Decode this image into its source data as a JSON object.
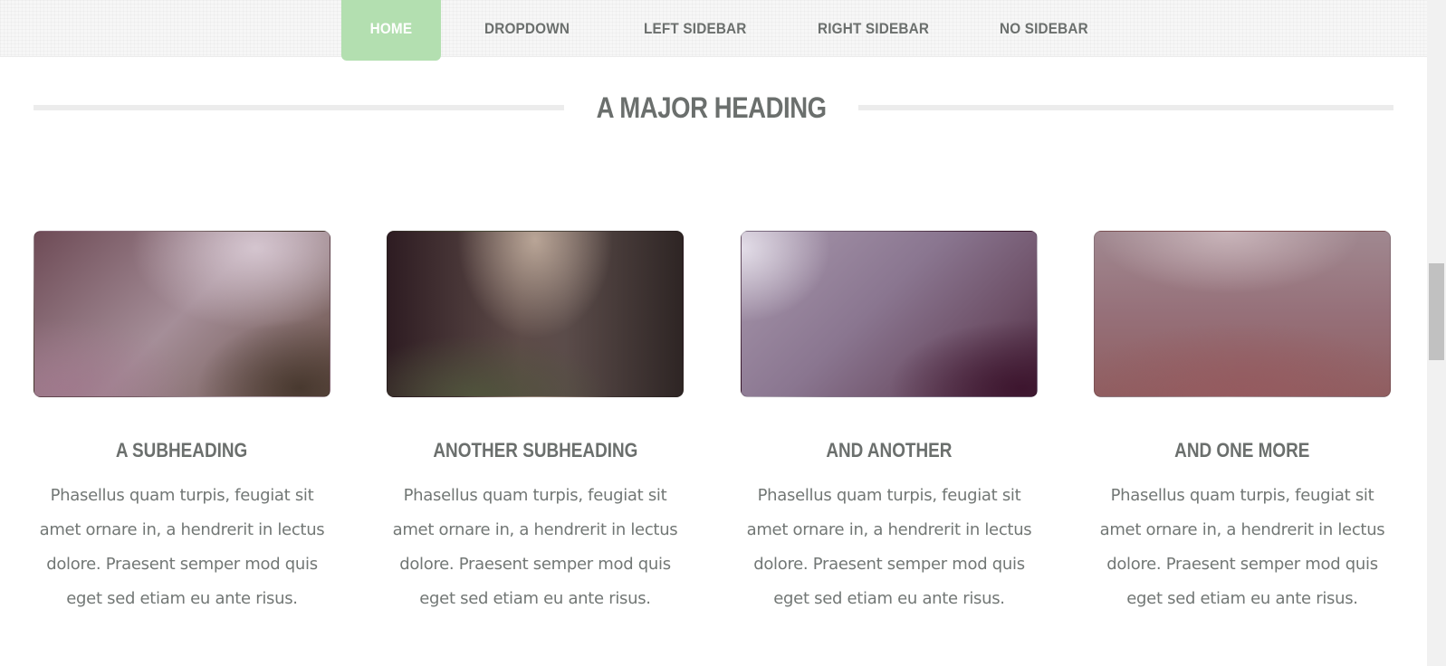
{
  "nav": {
    "items": [
      {
        "label": "HOME",
        "active": true
      },
      {
        "label": "DROPDOWN",
        "active": false
      },
      {
        "label": "LEFT SIDEBAR",
        "active": false
      },
      {
        "label": "RIGHT SIDEBAR",
        "active": false
      },
      {
        "label": "NO SIDEBAR",
        "active": false
      }
    ],
    "active_color": "#b3dfb0"
  },
  "main": {
    "heading": "A MAJOR HEADING",
    "features": [
      {
        "title": "A SUBHEADING",
        "text": "Phasellus quam turpis, feugiat sit amet ornare in, a hendrerit in lectus dolore. Praesent semper mod quis eget sed etiam eu ante risus."
      },
      {
        "title": "ANOTHER SUBHEADING",
        "text": "Phasellus quam turpis, feugiat sit amet ornare in, a hendrerit in lectus dolore. Praesent semper mod quis eget sed etiam eu ante risus."
      },
      {
        "title": "AND ANOTHER",
        "text": "Phasellus quam turpis, feugiat sit amet ornare in, a hendrerit in lectus dolore. Praesent semper mod quis eget sed etiam eu ante risus."
      },
      {
        "title": "AND ONE MORE",
        "text": "Phasellus quam turpis, feugiat sit amet ornare in, a hendrerit in lectus dolore. Praesent semper mod quis eget sed etiam eu ante risus."
      }
    ]
  },
  "colors": {
    "text": "#6b6f6d",
    "body_text": "#727775",
    "rule": "#ececec"
  }
}
